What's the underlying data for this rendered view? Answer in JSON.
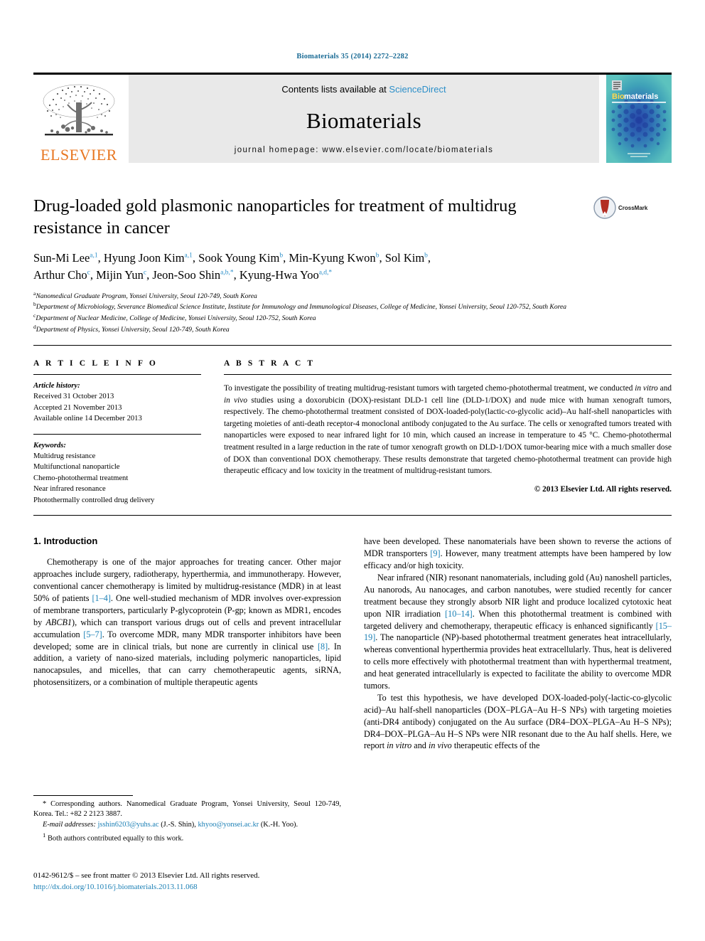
{
  "running_head": "Biomaterials 35 (2014) 2272–2282",
  "banner": {
    "publisher": "ELSEVIER",
    "contents_prefix": "Contents lists available at ",
    "contents_link": "ScienceDirect",
    "journal_name": "Biomaterials",
    "homepage": "journal homepage: www.elsevier.com/locate/biomaterials",
    "cover_title_bio": "Bio",
    "cover_title_materials": "materials"
  },
  "article": {
    "title": "Drug-loaded gold plasmonic nanoparticles for treatment of multidrug resistance in cancer",
    "crossmark_label": "CrossMark",
    "authors_line1": "Sun-Mi Lee a,1, Hyung Joon Kim a,1, Sook Young Kim b, Min-Kyung Kwon b, Sol Kim b,",
    "authors_line2": "Arthur Cho c, Mijin Yun c, Jeon-Soo Shin a,b,*, Kyung-Hwa Yoo a,d,*",
    "affiliations": [
      "a Nanomedical Graduate Program, Yonsei University, Seoul 120-749, South Korea",
      "b Department of Microbiology, Severance Biomedical Science Institute, Institute for Immunology and Immunological Diseases, College of Medicine, Yonsei University, Seoul 120-752, South Korea",
      "c Department of Nuclear Medicine, College of Medicine, Yonsei University, Seoul 120-752, South Korea",
      "d Department of Physics, Yonsei University, Seoul 120-749, South Korea"
    ]
  },
  "article_info": {
    "heading": "A R T I C L E   I N F O",
    "history_label": "Article history:",
    "history": [
      "Received 31 October 2013",
      "Accepted 21 November 2013",
      "Available online 14 December 2013"
    ],
    "keywords_label": "Keywords:",
    "keywords": [
      "Multidrug resistance",
      "Multifunctional nanoparticle",
      "Chemo-photothermal treatment",
      "Near infrared resonance",
      "Photothermally controlled drug delivery"
    ]
  },
  "abstract": {
    "heading": "A B S T R A C T",
    "text": "To investigate the possibility of treating multidrug-resistant tumors with targeted chemo-photothermal treatment, we conducted in vitro and in vivo studies using a doxorubicin (DOX)-resistant DLD-1 cell line (DLD-1/DOX) and nude mice with human xenograft tumors, respectively. The chemo-photothermal treatment consisted of DOX-loaded-poly(lactic-co-glycolic acid)–Au half-shell nanoparticles with targeting moieties of anti-death receptor-4 monoclonal antibody conjugated to the Au surface. The cells or xenografted tumors treated with nanoparticles were exposed to near infrared light for 10 min, which caused an increase in temperature to 45 °C. Chemo-photothermal treatment resulted in a large reduction in the rate of tumor xenograft growth on DLD-1/DOX tumor-bearing mice with a much smaller dose of DOX than conventional DOX chemotherapy. These results demonstrate that targeted chemo-photothermal treatment can provide high therapeutic efficacy and low toxicity in the treatment of multidrug-resistant tumors.",
    "copyright": "© 2013 Elsevier Ltd. All rights reserved."
  },
  "introduction": {
    "heading": "1. Introduction",
    "left_paragraphs": [
      "Chemotherapy is one of the major approaches for treating cancer. Other major approaches include surgery, radiotherapy, hyperthermia, and immunotherapy. However, conventional cancer chemotherapy is limited by multidrug-resistance (MDR) in at least 50% of patients [1–4]. One well-studied mechanism of MDR involves over-expression of membrane transporters, particularly P-glycoprotein (P-gp; known as MDR1, encodes by ABCB1), which can transport various drugs out of cells and prevent intracellular accumulation [5–7]. To overcome MDR, many MDR transporter inhibitors have been developed; some are in clinical trials, but none are currently in clinical use [8]. In addition, a variety of nano-sized materials, including polymeric nanoparticles, lipid nanocapsules, and micelles, that can carry chemotherapeutic agents, siRNA, photosensitizers, or a combination of multiple therapeutic agents"
    ],
    "right_paragraphs": [
      "have been developed. These nanomaterials have been shown to reverse the actions of MDR transporters [9]. However, many treatment attempts have been hampered by low efficacy and/or high toxicity.",
      "Near infrared (NIR) resonant nanomaterials, including gold (Au) nanoshell particles, Au nanorods, Au nanocages, and carbon nanotubes, were studied recently for cancer treatment because they strongly absorb NIR light and produce localized cytotoxic heat upon NIR irradiation [10–14]. When this photothermal treatment is combined with targeted delivery and chemotherapy, therapeutic efficacy is enhanced significantly [15–19]. The nanoparticle (NP)-based photothermal treatment generates heat intracellularly, whereas conventional hyperthermia provides heat extracellularly. Thus, heat is delivered to cells more effectively with photothermal treatment than with hyperthermal treatment, and heat generated intracellularly is expected to facilitate the ability to overcome MDR tumors.",
      "To test this hypothesis, we have developed DOX-loaded-poly(-lactic-co-glycolic acid)–Au half-shell nanoparticles (DOX–PLGA–Au H–S NPs) with targeting moieties (anti-DR4 antibody) conjugated on the Au surface (DR4–DOX–PLGA–Au H–S NPs); DR4–DOX–PLGA–Au H–S NPs were NIR resonant due to the Au half shells. Here, we report in vitro and in vivo therapeutic effects of the"
    ]
  },
  "footnotes": {
    "corresponding": "* Corresponding authors. Nanomedical Graduate Program, Yonsei University, Seoul 120-749, Korea. Tel.: +82 2 2123 3887.",
    "email_label": "E-mail addresses:",
    "email1": "jsshin6203@yuhs.ac",
    "email1_owner": "(J.-S. Shin),",
    "email2": "khyoo@yonsei.ac.kr",
    "email2_owner": "(K.-H. Yoo).",
    "equal_contrib_marker": "1",
    "equal_contrib": "Both authors contributed equally to this work."
  },
  "bottom": {
    "issn_line": "0142-9612/$ – see front matter © 2013 Elsevier Ltd. All rights reserved.",
    "doi": "http://dx.doi.org/10.1016/j.biomaterials.2013.11.068"
  },
  "colors": {
    "link": "#1a7fb5",
    "running_head": "#1a6b95",
    "elsevier_orange": "#E87722",
    "sciencedirect": "#2c8fc9",
    "banner_grey": "#e9e9e9"
  }
}
